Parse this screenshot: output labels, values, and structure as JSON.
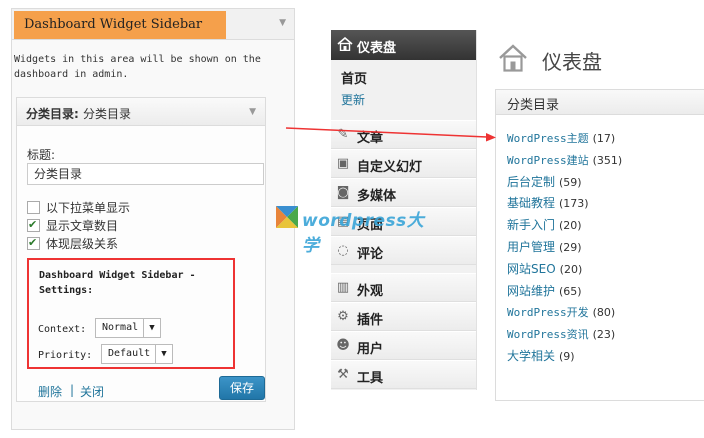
{
  "left_panel": {
    "title": "Dashboard Widget Sidebar",
    "description": "Widgets in this area will be shown on the dashboard in admin.",
    "widget": {
      "header_title": "分类目录",
      "header_subtitle": "分类目录",
      "title_label": "标题:",
      "title_value": "分类目录",
      "checkboxes": [
        {
          "label": "以下拉菜单显示",
          "checked": false
        },
        {
          "label": "显示文章数目",
          "checked": true
        },
        {
          "label": "体现层级关系",
          "checked": true
        }
      ],
      "settings": {
        "title": "Dashboard Widget Sidebar - Settings:",
        "context_label": "Context:",
        "context_value": "Normal",
        "priority_label": "Priority:",
        "priority_value": "Default"
      },
      "delete_link": "删除",
      "separator": "|",
      "close_link": "关闭",
      "save_button": "保存"
    }
  },
  "admin_menu": {
    "dashboard": "仪表盘",
    "home": "首页",
    "update": "更新",
    "items": [
      {
        "label": "文章",
        "icon": "pin-icon"
      },
      {
        "label": "自定义幻灯",
        "icon": "slides-icon"
      },
      {
        "label": "多媒体",
        "icon": "media-icon"
      },
      {
        "label": "页面",
        "icon": "page-icon"
      },
      {
        "label": "评论",
        "icon": "comment-icon"
      },
      {
        "label": "外观",
        "icon": "appearance-icon"
      },
      {
        "label": "插件",
        "icon": "plugin-icon"
      },
      {
        "label": "用户",
        "icon": "users-icon"
      },
      {
        "label": "工具",
        "icon": "tools-icon"
      }
    ]
  },
  "dashboard": {
    "title": "仪表盘",
    "box_title": "分类目录",
    "categories": [
      {
        "name": "WordPress主题",
        "count": "(17)",
        "latin": true
      },
      {
        "name": "WordPress建站",
        "count": "(351)",
        "latin": true
      },
      {
        "name": "后台定制",
        "count": "(59)",
        "latin": false
      },
      {
        "name": "基础教程",
        "count": "(173)",
        "latin": false
      },
      {
        "name": "新手入门",
        "count": "(20)",
        "latin": false
      },
      {
        "name": "用户管理",
        "count": "(29)",
        "latin": false
      },
      {
        "name": "网站SEO",
        "count": "(20)",
        "latin": false
      },
      {
        "name": "网站维护",
        "count": "(65)",
        "latin": false
      },
      {
        "name": "WordPress开发",
        "count": "(80)",
        "latin": true
      },
      {
        "name": "WordPress资讯",
        "count": "(23)",
        "latin": true
      },
      {
        "name": "大学相关",
        "count": "(9)",
        "latin": false
      }
    ]
  },
  "watermark": {
    "text": "wordpress大学"
  },
  "colors": {
    "accent": "#f5a04b",
    "link": "#21759b",
    "highlight": "#e33333",
    "button": "#2176a8"
  }
}
